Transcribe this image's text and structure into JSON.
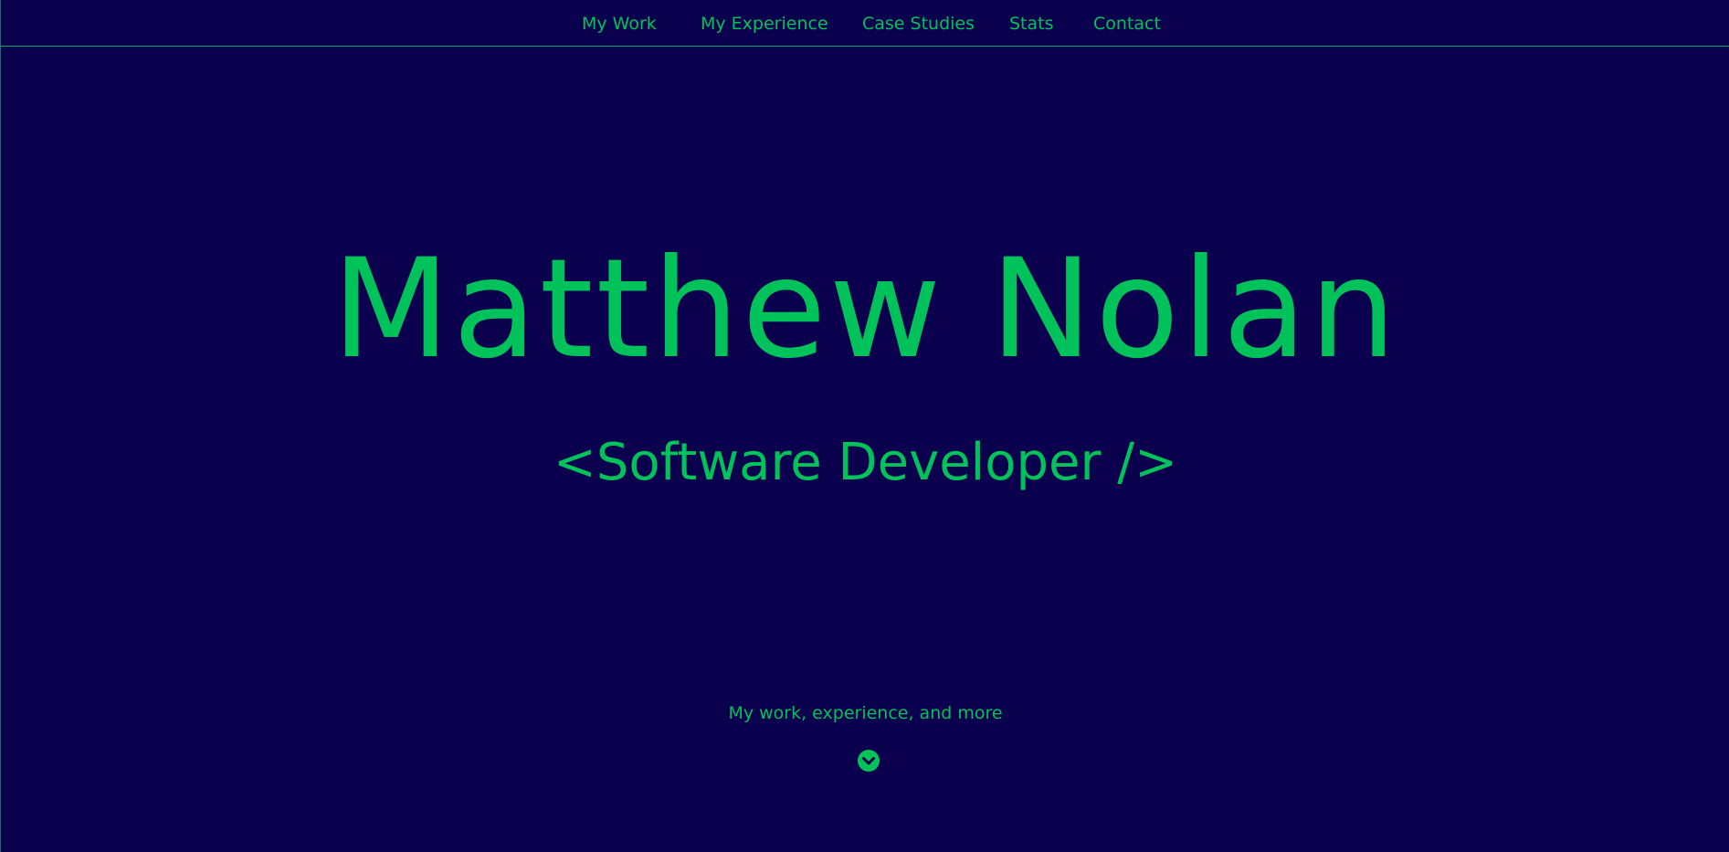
{
  "nav": {
    "items": [
      {
        "label": "My Work"
      },
      {
        "label": "My Experience"
      },
      {
        "label": "Case Studies"
      },
      {
        "label": "Stats"
      },
      {
        "label": "Contact"
      }
    ]
  },
  "hero": {
    "name": "Matthew Nolan",
    "role": "<Software Developer />"
  },
  "cta": {
    "text": "My work, experience, and more",
    "icon": "chevron-down-circle-icon"
  },
  "colors": {
    "background": "#0a004d",
    "accent": "#00c25a",
    "divider": "#00a86a"
  }
}
